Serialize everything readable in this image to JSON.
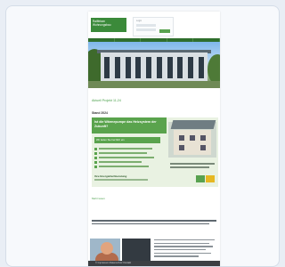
{
  "header": {
    "logo_lines": [
      "Raiffeisen",
      "Wohnungsbau"
    ],
    "login_label": "Login"
  },
  "main": {
    "link_text": "Aktuell Projekt 11-24",
    "section_date": "Stand 2024"
  },
  "banner": {
    "headline": "Ist die Wärmepumpe das Heizsystem der Zukunft?",
    "subline": "Wir laden Sie herzlich ein",
    "footer_text": "Ihre Energiefachberatung"
  },
  "links": {
    "more": "Mehr lesen"
  },
  "footer": {
    "text": "© Impressum Datenschutz Kontakt"
  },
  "colors": {
    "brand_green": "#3b8a3a",
    "accent_green": "#5aa34d",
    "nav_dark": "#2f6e2d",
    "footer_dark": "#3c3f43"
  }
}
